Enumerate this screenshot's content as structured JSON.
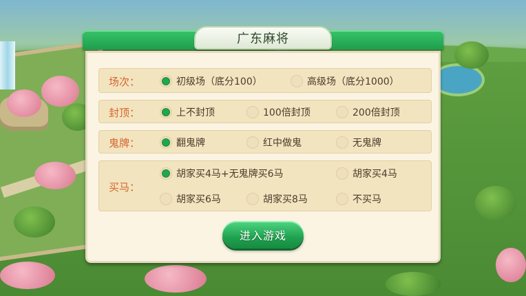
{
  "dialog": {
    "title": "广东麻将",
    "enter_button_label": "进入游戏"
  },
  "rows": {
    "room": {
      "label": "场次：",
      "options": [
        {
          "label": "初级场（底分100）",
          "selected": true
        },
        {
          "label": "高级场（底分1000）",
          "selected": false
        }
      ]
    },
    "cap": {
      "label": "封顶：",
      "options": [
        {
          "label": "上不封顶",
          "selected": true
        },
        {
          "label": "100倍封顶",
          "selected": false
        },
        {
          "label": "200倍封顶",
          "selected": false
        }
      ]
    },
    "ghost": {
      "label": "鬼牌：",
      "options": [
        {
          "label": "翻鬼牌",
          "selected": true
        },
        {
          "label": "红中做鬼",
          "selected": false
        },
        {
          "label": "无鬼牌",
          "selected": false
        }
      ]
    },
    "horse": {
      "label": "买马：",
      "options": [
        {
          "label": "胡家买4马+无鬼牌买6马",
          "selected": true
        },
        {
          "label": "胡家买4马",
          "selected": false
        },
        {
          "label": "胡家买6马",
          "selected": false
        },
        {
          "label": "胡家买8马",
          "selected": false
        },
        {
          "label": "不买马",
          "selected": false
        }
      ]
    }
  },
  "colors": {
    "header_green": "#1f9e4c",
    "label_orange": "#d2652a",
    "selected_radio": "#22a64c",
    "panel_bg": "#fbf4e3"
  }
}
